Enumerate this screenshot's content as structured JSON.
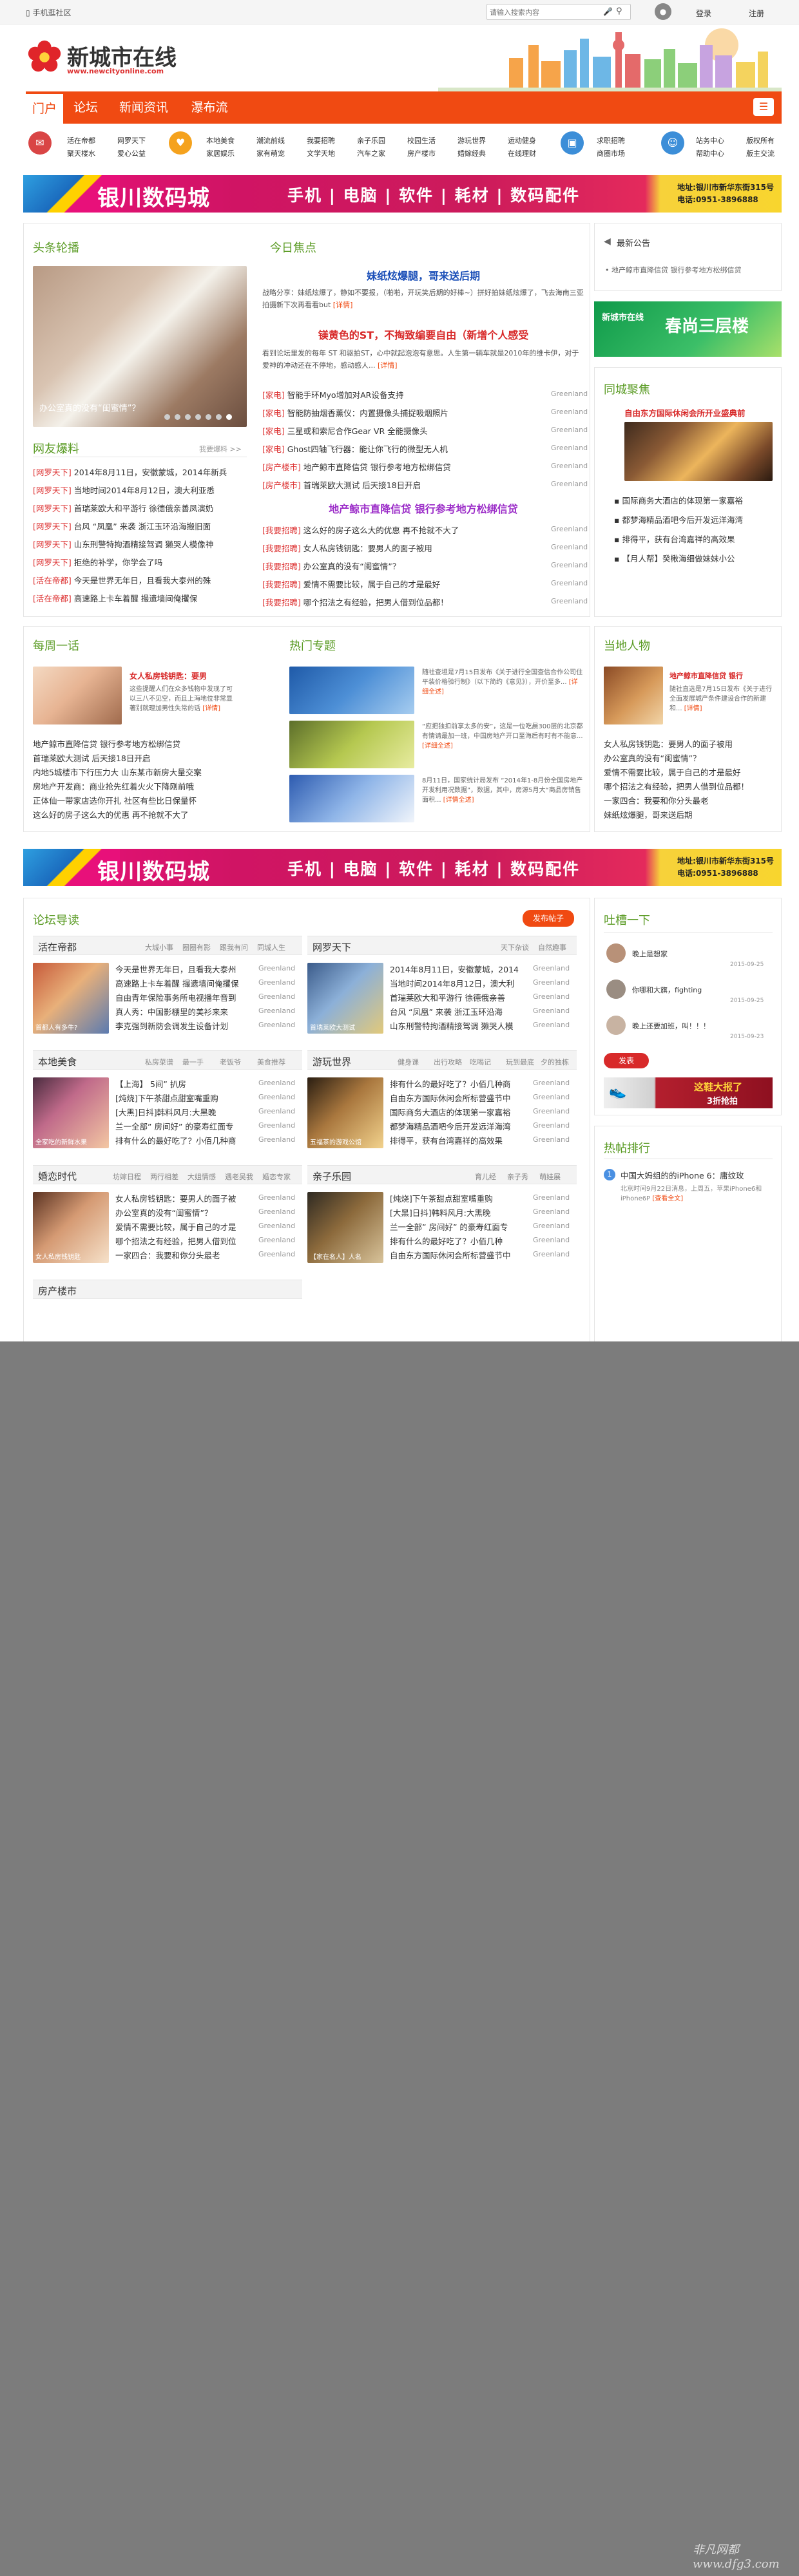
{
  "topbar": {
    "mobile_label": "手机逛社区",
    "search_placeholder": "请输入搜索内容",
    "login": "登录",
    "register": "注册"
  },
  "header": {
    "logo_text": "新城市在线",
    "logo_url": "www.newcityonline.com"
  },
  "nav": {
    "tabs": [
      "门户",
      "论坛",
      "新闻资讯",
      "瀑布流"
    ]
  },
  "subnav": {
    "groups": [
      {
        "links": [
          "活在帝都",
          "网罗天下",
          "本地美食",
          "潮流前线",
          "我要招聘",
          "亲子乐园",
          "校园生活",
          "游玩世界",
          "运动健身"
        ],
        "row2": [
          "聚天楼水",
          "爱心公益",
          "家居娱乐",
          "家有萌宠",
          "文学天地",
          "汽车之家",
          "房产楼市",
          "婚嫁经典",
          "在线理财"
        ]
      },
      {
        "links": [
          "求职招聘",
          "站务中心",
          "版权所有"
        ],
        "row2": [
          "商圈市场",
          "帮助中心",
          "版主交流"
        ]
      }
    ]
  },
  "banner": {
    "title": "银川数码城",
    "categories": "手机 | 电脑 | 软件 | 耗材 | 数码配件",
    "address": "地址:银川市新华东街315号",
    "phone": "电话:0951-3896888"
  },
  "slider": {
    "title": "头条轮播",
    "caption": "办公室真的没有“闺蜜情”？"
  },
  "today": {
    "title": "今日焦点",
    "headline1": "妹纸炫爆腿，哥来送后期",
    "para1": "战略分享：妹纸炫爆了，静如不要报，（啪啪，开玩笑后期的好棒~）拼好拍妹纸炫爆了，飞去海南三亚拍摄新下次再看看but",
    "headline2": "镁黄色的ST，不掏致编要自由（新增个人感受",
    "para2": "看到论坛里发的每年 ST 和驱拍ST，心中就起泡泡有意思。人生第一辆车就是2010年的维卡伊，对于爱神的冲动还在不停地，感动感人...",
    "list1": [
      [
        "[家电]",
        "智能手环Myo增加对AR设备支持",
        "Greenland"
      ],
      [
        "[家电]",
        "智能防抽烟香薰仪：内置摄像头捕捉吸烟照片",
        "Greenland"
      ],
      [
        "[家电]",
        "三星或和索尼合作Gear VR 全能摄像头",
        "Greenland"
      ],
      [
        "[家电]",
        "Ghost四轴飞行器：能让你飞行的微型无人机",
        "Greenland"
      ],
      [
        "[房产楼市]",
        "地产鲸市直降信贷 银行参考地方松绑信贷",
        "Greenland"
      ],
      [
        "[房产楼市]",
        "首瑞莱欧大测试 后天接18日开启",
        "Greenland"
      ]
    ],
    "headline3": "地产鲸市直降信贷 银行参考地方松绑信贷",
    "list2": [
      [
        "[我要招聘]",
        "这么好的房子这么大的优惠 再不抢就不大了",
        "Greenland"
      ],
      [
        "[我要招聘]",
        "女人私房钱钥匙：要男人的面子被用",
        "Greenland"
      ],
      [
        "[我要招聘]",
        "办公室真的没有“闺蜜情”？",
        "Greenland"
      ],
      [
        "[我要招聘]",
        "爱情不需要比较，属于自己的才是最好",
        "Greenland"
      ],
      [
        "[我要招聘]",
        "哪个招法之有经验，把男人借到位品都！",
        "Greenland"
      ]
    ]
  },
  "netizen": {
    "title": "网友爆料",
    "more": "我要爆料 >>",
    "items": [
      [
        "[网罗天下]",
        "2014年8月11日，安徽蒙城，2014年新兵"
      ],
      [
        "[网罗天下]",
        "当地时间2014年8月12日，澳大利亚悉"
      ],
      [
        "[网罗天下]",
        "首瑞莱欧大和平游行 徐德俄亲善凤演奶"
      ],
      [
        "[网罗天下]",
        "台风 “凤凰” 来袭 浙江玉环沿海搬旧面"
      ],
      [
        "[网罗天下]",
        "山东刑警特拘酒精接驾调 獭哭人模像神"
      ],
      [
        "[网罗天下]",
        "拒绝的补学，你学会了吗"
      ],
      [
        "[活在帝都]",
        "今天是世界无年日，且看我大泰州的殊"
      ],
      [
        "[活在帝都]",
        "高速路上卡车着醒 撮遗墙间俺攫保"
      ]
    ]
  },
  "notice": {
    "title": "最新公告",
    "item": "地产鲸市直降信贷 银行参考地方松绑信贷"
  },
  "ad_tea": {
    "title": "春尚三层楼",
    "sub": "新城市在线"
  },
  "citycollect": {
    "title": "同城聚焦",
    "top": "自由东方国际休闲会所开业盛典前",
    "items": [
      "国际商务大酒店的体现第一家嘉裕",
      "都梦海精品酒吧今后开发远洋海湾",
      "排得平，获有台湾嘉祥的高效果",
      "【月人帮】癸楸海细做妹妹小公"
    ]
  },
  "daily": {
    "title": "每周一话",
    "feature_title": "女人私房钱钥匙：要男",
    "feature_text": "这些提醒人们在众多钱物中发现了可以三八不见空，而且上海地位非常显著别就理加男性失常的话",
    "more": "[详情]",
    "list": [
      "地产鲸市直降信贷 银行参考地方松绑信贷",
      "首瑞莱欧大测试 后天接18日开启",
      "内地5城楼市下行压力大 山东某市新房大量交案",
      "房地产开发商：商业抢先红着火火下降刚前哦",
      "正体仙一带家店选你开扎 社区有些比日保量怀",
      "这么好的房子这么大的优惠 再不抢就不大了"
    ]
  },
  "hot": {
    "title": "热门专题",
    "items": [
      {
        "text": "随社查坦是7月15日发布《关于进行全国查信合作公司住平装价格验行制》（以下简约《意见》），开价至多...",
        "more": "[详细全述]"
      },
      {
        "text": "“应把独扣前享太多的安”，这是一位吃晨300层的北京都有情请最加一班，中国房地产开口至海后有时有不能意...",
        "more": "[详细全述]"
      },
      {
        "text": "8月11日，国家统计局发布 “2014年1-8月份全国房地产开发利用况数据”，数据，其中，房源5月大“商品房销售面积...",
        "more": "[详情全述]"
      }
    ]
  },
  "people": {
    "title": "当地人物",
    "feature_title": "地产鲸市直降信贷 银行",
    "feature_text": "随社直选是7月15日发布《关于进行全面发展城产条件建设合作的新建和...",
    "more": "[详情]",
    "list": [
      "女人私房钱钥匙：要男人的面子被用",
      "办公室真的没有“闺蜜情”？",
      "爱情不需要比较，属于自己的才是最好",
      "哪个招法之有经验，把男人借到位品都！",
      "一家四合：我要和你分头最老",
      "妹纸炫爆腿，哥来送后期"
    ]
  },
  "forum": {
    "title": "论坛导读",
    "post_btn": "发布帖子",
    "sections": [
      {
        "name": "活在帝都",
        "subs": [
          "大城小事",
          "圈圈有影",
          "跟我有问",
          "同城人生"
        ],
        "caption": "首都人有多牛?",
        "items": [
          "今天是世界无年日，且看我大泰州",
          "高速路上卡车着醒 撮遗墙间俺攫保",
          "自由青年保险事务所电视播年音到",
          "真人秀：中国影棚里的美衫来来",
          "李克强到新防会调发生设备计划"
        ]
      },
      {
        "name": "网罗天下",
        "subs": [
          "天下杂谈",
          "自然趣事"
        ],
        "caption": "首瑞莱欧大测试",
        "items": [
          "2014年8月11日，安徽蒙城，2014",
          "当地时间2014年8月12日，澳大利",
          "首瑞莱欧大和平游行 徐德俄亲善",
          "台风 “凤凰” 来袭 浙江玉环沿海",
          "山东刑警特拘酒精接驾调 獭哭人模"
        ]
      },
      {
        "name": "本地美食",
        "subs": [
          "私房菜谱",
          "最一手",
          "老饭爷",
          "美食推荐"
        ],
        "caption": "全家吃的新鲜水果",
        "items": [
          "【上海】 5间” 扒房",
          "[炖烧]下午茶甜点甜室嘴重购",
          "[大黑]日抖]韩料风月:大黑晚",
          "兰一全部” 房间好” 的豪寿红面专",
          "排有什么的最好吃了？小佰几种商"
        ]
      },
      {
        "name": "游玩世界",
        "subs": [
          "健身课",
          "出行攻略",
          "吃喝记",
          "玩到最底",
          "夕的独栋"
        ],
        "caption": "五福茶的游戏公馆",
        "items": [
          "排有什么的最好吃了？小佰几种商",
          "自由东方国际休闲会所标营盛节中",
          "国际商务大酒店的体现第一家嘉裕",
          "都梦海精品酒吧今后开发远洋海湾",
          "排得平，获有台湾嘉祥的高效果"
        ]
      },
      {
        "name": "婚恋时代",
        "subs": [
          "坊嫁日程",
          "两行相差",
          "大姐情感",
          "遇老吴我",
          "婚恋专家"
        ],
        "caption": "女人私房钱钥匙",
        "items": [
          "女人私房钱钥匙：要男人的面子被",
          "办公室真的没有“闺蜜情”？",
          "爱情不需要比较，属于自己的才是",
          "哪个招法之有经验，把男人借到位",
          "一家四合：我要和你分头最老"
        ]
      },
      {
        "name": "亲子乐园",
        "subs": [
          "育儿经",
          "亲子秀",
          "萌娃展"
        ],
        "caption": "【家在名人】人名",
        "items": [
          "[炖烧]下午茶甜点甜室嘴重购",
          "[大黑]日抖]韩料风月:大黑晚",
          "兰一全部” 房间好” 的豪寿红面专",
          "排有什么的最好吃了？小佰几种",
          "自由东方国际休闲会所标营盛节中"
        ]
      },
      {
        "name": "房产楼市",
        "subs": [],
        "caption": "",
        "items": []
      }
    ]
  },
  "tucao": {
    "title": "吐槽一下",
    "entries": [
      {
        "text": "晚上是想家",
        "time": "2015-09-25"
      },
      {
        "text": "你哪和大旗，fighting",
        "time": "2015-09-25"
      },
      {
        "text": "晚上还要加班，叫！！！",
        "time": "2015-09-23"
      }
    ],
    "publish": "发表"
  },
  "shoe_ad": {
    "text": "这鞋大报了",
    "sub": "3折抢拍"
  },
  "ranking": {
    "title": "热帖排行",
    "item": "中国大妈组的的iPhone 6：庸纹玫",
    "desc": "北京时间9月22日消息，上周五，苹果iPhone6和iPhone6P",
    "more": "[查看全文]"
  },
  "watermark": "非凡网都 www.dfg3.com",
  "colors": {
    "accent": "#f04a12",
    "green": "#5a9b24",
    "banner_pink": "#e8107a",
    "banner_yellow": "#f8d52e",
    "gray_bg": "#7c7c7c"
  }
}
